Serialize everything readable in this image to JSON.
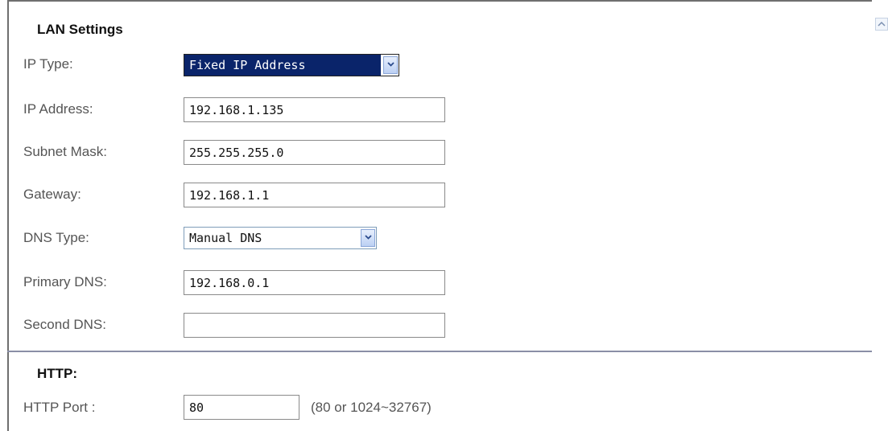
{
  "lan": {
    "title": "LAN Settings",
    "ip_type": {
      "label": "IP Type:",
      "value": "Fixed IP Address"
    },
    "ip_address": {
      "label": "IP Address:",
      "value": "192.168.1.135"
    },
    "subnet_mask": {
      "label": "Subnet Mask:",
      "value": "255.255.255.0"
    },
    "gateway": {
      "label": "Gateway:",
      "value": "192.168.1.1"
    },
    "dns_type": {
      "label": "DNS Type:",
      "value": "Manual DNS"
    },
    "primary_dns": {
      "label": "Primary DNS:",
      "value": "192.168.0.1"
    },
    "second_dns": {
      "label": "Second DNS:",
      "value": ""
    }
  },
  "http": {
    "title": "HTTP:",
    "port": {
      "label": "HTTP Port :",
      "value": "80",
      "hint": "(80 or 1024~32767)"
    }
  },
  "icons": {
    "dropdown": "chevron-down-icon",
    "scroll": "scroll-up-arrow-icon"
  },
  "colors": {
    "selection_bg": "#0a246a",
    "label_text": "#555555",
    "divider": "#8a8fa6"
  }
}
